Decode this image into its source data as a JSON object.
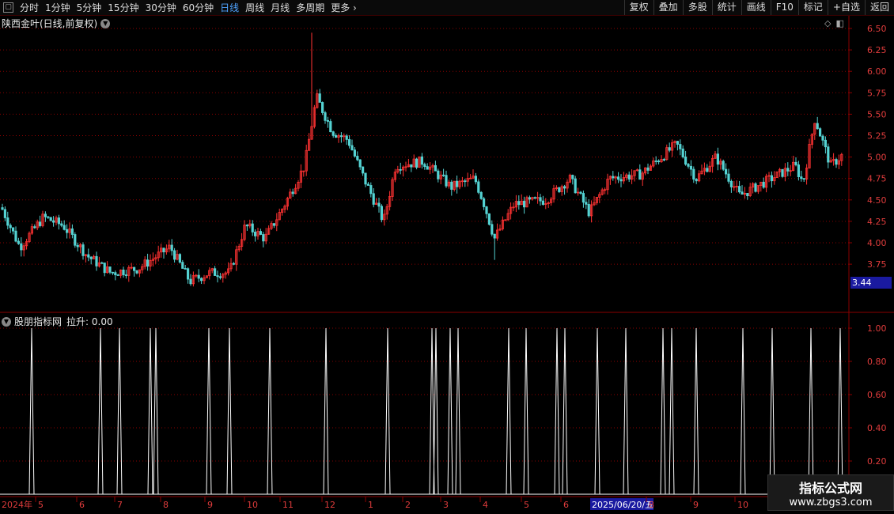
{
  "toolbar": {
    "periods": [
      "分时",
      "1分钟",
      "5分钟",
      "15分钟",
      "30分钟",
      "60分钟",
      "日线",
      "周线",
      "月线",
      "多周期",
      "更多 ›"
    ],
    "active_period": "日线",
    "buttons": [
      "复权",
      "叠加",
      "多股",
      "统计",
      "画线",
      "F10",
      "标记",
      "+自选",
      "返回"
    ]
  },
  "title": "陕西金叶(日线,前复权)",
  "price_axis": {
    "ticks": [
      "6.50",
      "6.25",
      "6.00",
      "5.75",
      "5.50",
      "5.25",
      "5.00",
      "4.75",
      "4.50",
      "4.25",
      "4.00",
      "3.75"
    ],
    "current_label": "3.44"
  },
  "indicator": {
    "title": "股朋指标网",
    "value_label": "拉升: 0.00",
    "ticks": [
      "1.00",
      "0.80",
      "0.60",
      "0.40",
      "0.20"
    ]
  },
  "time_axis": {
    "labels": [
      "2024年",
      "5",
      "6",
      "7",
      "8",
      "9",
      "10",
      "11",
      "12",
      "1",
      "2",
      "3",
      "4",
      "5",
      "6",
      "2025/06/20/五",
      "8",
      "9",
      "10"
    ],
    "highlight": "2025/06/20/五"
  },
  "watermark": {
    "line1": "指标公式网",
    "line2": "www.zbgs3.com"
  },
  "colors": {
    "up": "#ff3232",
    "down": "#54d2d2",
    "grid": "#8a0000",
    "axis_text": "#e03c3c",
    "cursor": "#1a1aa0"
  },
  "chart_data": [
    {
      "type": "candlestick",
      "ylim": [
        3.44,
        6.5
      ],
      "close_trend": [
        {
          "x": 0,
          "y": 4.45
        },
        {
          "x": 25,
          "y": 3.95
        },
        {
          "x": 55,
          "y": 4.3
        },
        {
          "x": 80,
          "y": 4.2
        },
        {
          "x": 110,
          "y": 3.85
        },
        {
          "x": 140,
          "y": 3.65
        },
        {
          "x": 175,
          "y": 3.7
        },
        {
          "x": 215,
          "y": 3.95
        },
        {
          "x": 240,
          "y": 3.55
        },
        {
          "x": 265,
          "y": 3.65
        },
        {
          "x": 290,
          "y": 3.65
        },
        {
          "x": 310,
          "y": 4.2
        },
        {
          "x": 335,
          "y": 4.05
        },
        {
          "x": 360,
          "y": 4.45
        },
        {
          "x": 385,
          "y": 4.9
        },
        {
          "x": 400,
          "y": 5.7
        },
        {
          "x": 420,
          "y": 5.3
        },
        {
          "x": 440,
          "y": 5.2
        },
        {
          "x": 460,
          "y": 4.75
        },
        {
          "x": 485,
          "y": 4.25
        },
        {
          "x": 500,
          "y": 4.9
        },
        {
          "x": 535,
          "y": 4.95
        },
        {
          "x": 570,
          "y": 4.65
        },
        {
          "x": 600,
          "y": 4.75
        },
        {
          "x": 612,
          "y": 4.45
        },
        {
          "x": 625,
          "y": 4.05
        },
        {
          "x": 650,
          "y": 4.45
        },
        {
          "x": 690,
          "y": 4.5
        },
        {
          "x": 720,
          "y": 4.75
        },
        {
          "x": 745,
          "y": 4.35
        },
        {
          "x": 770,
          "y": 4.75
        },
        {
          "x": 810,
          "y": 4.8
        },
        {
          "x": 855,
          "y": 5.15
        },
        {
          "x": 880,
          "y": 4.75
        },
        {
          "x": 905,
          "y": 5.0
        },
        {
          "x": 935,
          "y": 4.55
        },
        {
          "x": 975,
          "y": 4.75
        },
        {
          "x": 1005,
          "y": 4.9
        },
        {
          "x": 1015,
          "y": 4.7
        },
        {
          "x": 1030,
          "y": 5.45
        },
        {
          "x": 1050,
          "y": 4.9
        },
        {
          "x": 1068,
          "y": 5.05
        }
      ],
      "highs": [
        6.45
      ],
      "lows": [
        3.55
      ]
    },
    {
      "type": "line",
      "name": "拉升",
      "ylim": [
        0,
        1.05
      ],
      "spikes_x": [
        40,
        127,
        151,
        190,
        197,
        264,
        290,
        341,
        412,
        490,
        546,
        551,
        569,
        579,
        643,
        665,
        704,
        714,
        755,
        791,
        838,
        849,
        880,
        939,
        976,
        1025,
        1062
      ]
    }
  ]
}
